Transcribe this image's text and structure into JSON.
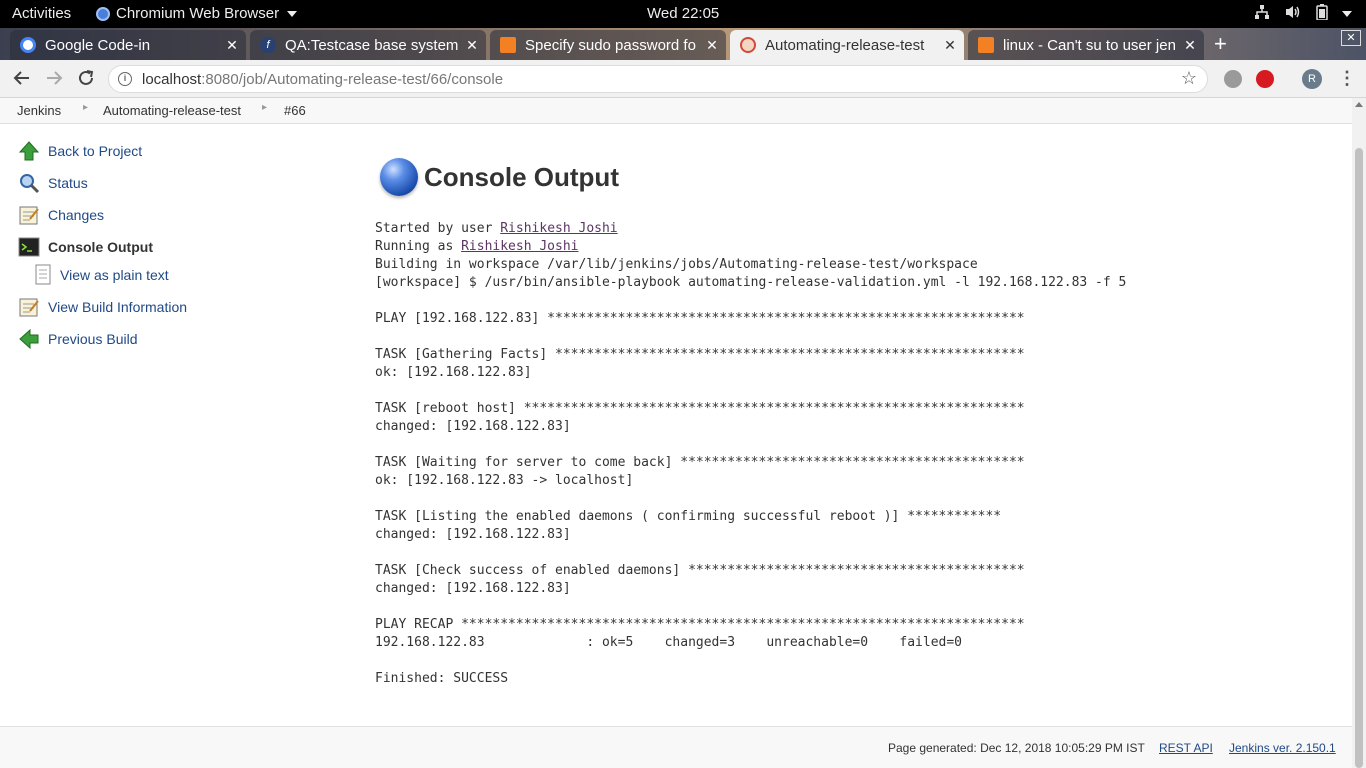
{
  "system_bar": {
    "activities": "Activities",
    "app_name": "Chromium Web Browser",
    "clock": "Wed 22:05",
    "icons": [
      "network-icon",
      "volume-icon",
      "battery-icon",
      "power-menu-icon"
    ]
  },
  "tabs": [
    {
      "title": "Google Code-in",
      "favicon": "google-favicon",
      "color": "#4285f4",
      "active": false
    },
    {
      "title": "QA:Testcase base system",
      "favicon": "fedora-favicon",
      "color": "#294172",
      "active": false
    },
    {
      "title": "Specify sudo password fo",
      "favicon": "stackexchange-favicon",
      "color": "#f48024",
      "active": false
    },
    {
      "title": "Automating-release-test",
      "favicon": "jenkins-favicon",
      "color": "#d24939",
      "active": true
    },
    {
      "title": "linux - Can't su to user jen",
      "favicon": "stackexchange-favicon",
      "color": "#f48024",
      "active": false
    }
  ],
  "address_bar": {
    "host": "localhost",
    "path": ":8080/job/Automating-release-test/66/console",
    "profile_initial": "R"
  },
  "breadcrumb": [
    "Jenkins",
    "Automating-release-test",
    "#66"
  ],
  "sidebar": [
    {
      "label": "Back to Project",
      "icon": "up-arrow-icon"
    },
    {
      "label": "Status",
      "icon": "magnifier-icon"
    },
    {
      "label": "Changes",
      "icon": "notepad-icon"
    },
    {
      "label": "Console Output",
      "icon": "terminal-icon",
      "active": true
    },
    {
      "label": "View as plain text",
      "icon": "document-icon",
      "indent": true
    },
    {
      "label": "View Build Information",
      "icon": "notepad-icon"
    },
    {
      "label": "Previous Build",
      "icon": "left-arrow-icon"
    }
  ],
  "page_title": "Console Output",
  "console": {
    "started_by_prefix": "Started by user ",
    "started_by_user": "Rishikesh Joshi",
    "running_as_prefix": "Running as ",
    "running_as_user": "Rishikesh Joshi",
    "lines": [
      "Building in workspace /var/lib/jenkins/jobs/Automating-release-test/workspace",
      "[workspace] $ /usr/bin/ansible-playbook automating-release-validation.yml -l 192.168.122.83 -f 5",
      "",
      "PLAY [192.168.122.83] *************************************************************",
      "",
      "TASK [Gathering Facts] ************************************************************",
      "ok: [192.168.122.83]",
      "",
      "TASK [reboot host] ****************************************************************",
      "changed: [192.168.122.83]",
      "",
      "TASK [Waiting for server to come back] ********************************************",
      "ok: [192.168.122.83 -> localhost]",
      "",
      "TASK [Listing the enabled daemons ( confirming successful reboot )] ************",
      "changed: [192.168.122.83]",
      "",
      "TASK [Check success of enabled daemons] *******************************************",
      "changed: [192.168.122.83]",
      "",
      "PLAY RECAP ************************************************************************",
      "192.168.122.83             : ok=5    changed=3    unreachable=0    failed=0",
      "",
      "Finished: SUCCESS"
    ]
  },
  "footer": {
    "generated": "Page generated: Dec 12, 2018 10:05:29 PM IST",
    "rest_api": "REST API",
    "version": "Jenkins ver. 2.150.1"
  }
}
